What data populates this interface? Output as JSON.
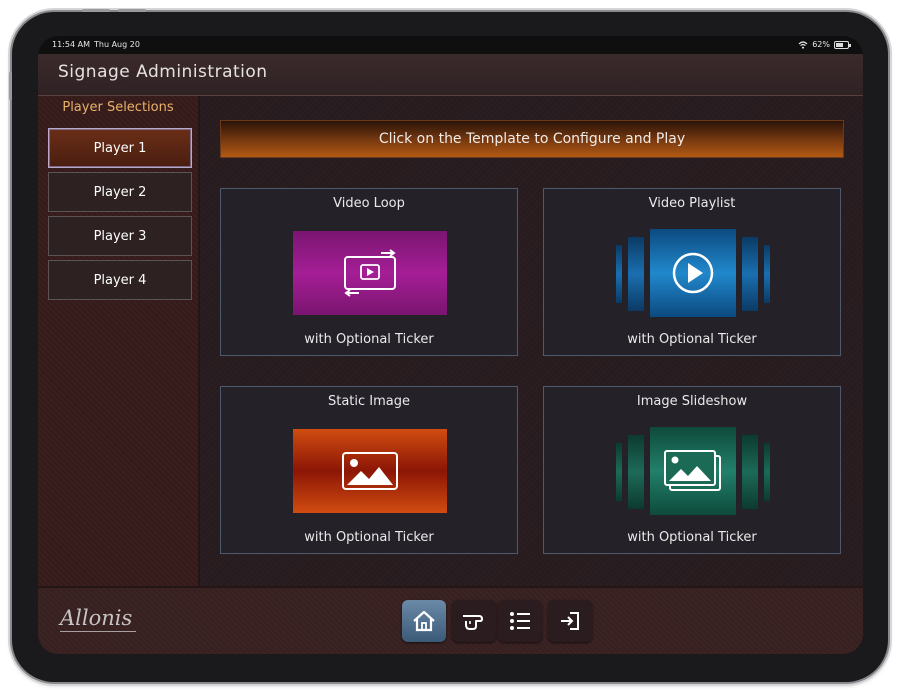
{
  "status_bar": {
    "time": "11:54 AM",
    "date": "Thu Aug 20",
    "battery": "62%"
  },
  "header": {
    "title": "Signage Administration"
  },
  "sidebar": {
    "title": "Player Selections",
    "players": [
      {
        "label": "Player 1",
        "selected": true
      },
      {
        "label": "Player 2",
        "selected": false
      },
      {
        "label": "Player 3",
        "selected": false
      },
      {
        "label": "Player 4",
        "selected": false
      }
    ]
  },
  "main": {
    "banner": "Click on the Template to Configure and Play",
    "templates": [
      {
        "title": "Video Loop",
        "subtitle": "with Optional Ticker",
        "icon": "video-loop-icon",
        "color": "#a51e96"
      },
      {
        "title": "Video Playlist",
        "subtitle": "with Optional Ticker",
        "icon": "play-icon",
        "color": "#1a6fb0"
      },
      {
        "title": "Static Image",
        "subtitle": "with Optional Ticker",
        "icon": "image-icon",
        "color": "#c23a10"
      },
      {
        "title": "Image Slideshow",
        "subtitle": "with Optional Ticker",
        "icon": "image-stack-icon",
        "color": "#1d6a58"
      }
    ]
  },
  "footer": {
    "logo": "Allonis",
    "nav": [
      {
        "icon": "home-icon",
        "active": true
      },
      {
        "icon": "pointing-hand-icon",
        "active": false
      },
      {
        "icon": "list-icon",
        "active": false
      },
      {
        "icon": "exit-icon",
        "active": false
      }
    ]
  }
}
